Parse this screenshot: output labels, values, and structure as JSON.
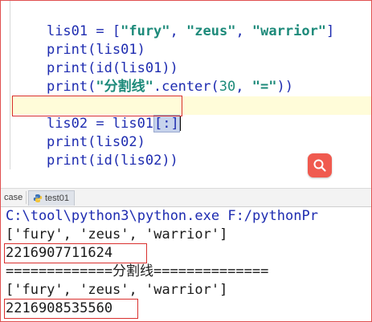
{
  "editor": {
    "lines": {
      "l1": {
        "name": "lis01",
        "eq": " = ",
        "open": "[",
        "s1": "\"fury\"",
        "c1": ", ",
        "s2": "\"zeus\"",
        "c2": ", ",
        "s3": "\"warrior\"",
        "close": "]"
      },
      "l2": {
        "func": "print",
        "open": "(",
        "arg": "lis01",
        "close": ")"
      },
      "l3": {
        "func": "print",
        "open": "(",
        "inner": "id",
        "open2": "(",
        "arg": "lis01",
        "close": "))"
      },
      "l4": {
        "func": "print",
        "open": "(",
        "str": "\"分割线\"",
        "method": ".center(",
        "num": "30",
        "comma": ", ",
        "str2": "\"=\"",
        "close": "))"
      },
      "l6": {
        "name": "lis02",
        "eq": " = ",
        "src": "lis01",
        "slice": "[:]"
      },
      "l7": {
        "func": "print",
        "open": "(",
        "arg": "lis02",
        "close": ")"
      },
      "l8": {
        "func": "print",
        "open": "(",
        "inner": "id",
        "open2": "(",
        "arg": "lis02",
        "close": "))"
      }
    },
    "search_button_icon": "search-icon",
    "accent_color": "#f05a4f"
  },
  "tabs": [
    {
      "label": "case"
    },
    {
      "label": "test01",
      "icon": "python-file-icon"
    }
  ],
  "console": {
    "command": "C:\\tool\\python3\\python.exe F:/pythonPr",
    "output": [
      "['fury', 'zeus', 'warrior']",
      "2216907711624",
      "=============分割线==============",
      "['fury', 'zeus', 'warrior']",
      "2216908535560"
    ]
  },
  "colors": {
    "highlight_box": "#d9302e",
    "keyword_blue": "#1d2bb0",
    "string_teal": "#1d8a7a",
    "current_line": "#fffcd9"
  }
}
